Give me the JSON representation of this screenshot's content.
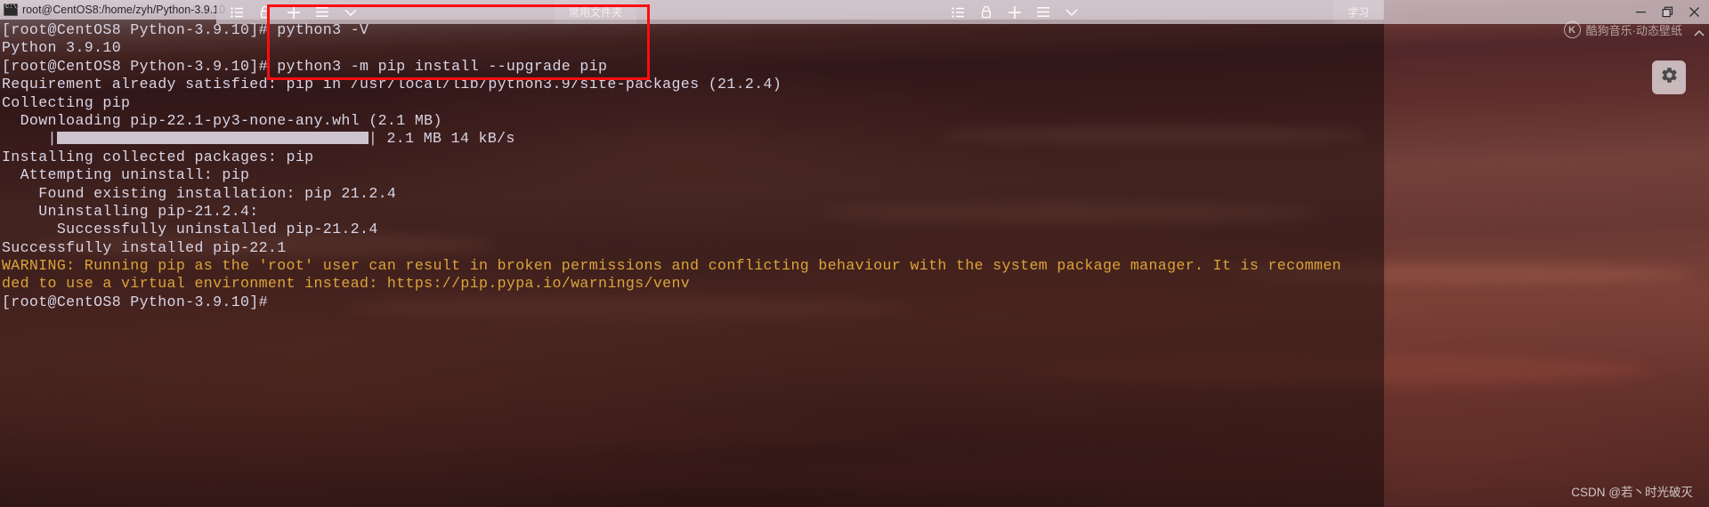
{
  "window": {
    "title": "root@CentOS8:/home/zyh/Python-3.9.10",
    "icon_name": "terminal-icon",
    "minimize_label": "Minimize",
    "maximize_label": "Maximize",
    "close_label": "Close"
  },
  "top_panel": {
    "icons_left": [
      {
        "name": "list-icon",
        "label": "List"
      },
      {
        "name": "lock-icon",
        "label": "Lock"
      },
      {
        "name": "plus-icon",
        "label": "New"
      },
      {
        "name": "hamburger-icon",
        "label": "Menu"
      },
      {
        "name": "chevron-down-icon",
        "label": "More"
      }
    ],
    "tab_favorites": "常用文件夹",
    "icons_right": [
      {
        "name": "list-icon",
        "label": "List"
      },
      {
        "name": "lock-icon",
        "label": "Lock"
      },
      {
        "name": "plus-icon",
        "label": "New"
      },
      {
        "name": "hamburger-icon",
        "label": "Menu"
      },
      {
        "name": "chevron-down-icon",
        "label": "More"
      }
    ],
    "tab_study": "学习"
  },
  "terminal": {
    "prompt": "[root@CentOS8 Python-3.9.10]#",
    "lines": [
      {
        "text": "[root@CentOS8 Python-3.9.10]# python3 -V",
        "color": "normal"
      },
      {
        "text": "Python 3.9.10",
        "color": "normal"
      },
      {
        "text": "[root@CentOS8 Python-3.9.10]# python3 -m pip install --upgrade pip",
        "color": "normal"
      },
      {
        "text": "Requirement already satisfied: pip in /usr/local/lib/python3.9/site-packages (21.2.4)",
        "color": "normal"
      },
      {
        "text": "Collecting pip",
        "color": "normal"
      },
      {
        "text": "  Downloading pip-22.1-py3-none-any.whl (2.1 MB)",
        "color": "normal"
      },
      {
        "text": "PROGRESS_BAR",
        "color": "bar"
      },
      {
        "text": "Installing collected packages: pip",
        "color": "normal"
      },
      {
        "text": "  Attempting uninstall: pip",
        "color": "normal"
      },
      {
        "text": "    Found existing installation: pip 21.2.4",
        "color": "normal"
      },
      {
        "text": "    Uninstalling pip-21.2.4:",
        "color": "normal"
      },
      {
        "text": "      Successfully uninstalled pip-21.2.4",
        "color": "normal"
      },
      {
        "text": "Successfully installed pip-22.1",
        "color": "normal"
      },
      {
        "text": "WARNING: Running pip as the 'root' user can result in broken permissions and conflicting behaviour with the system package manager. It is recommen",
        "color": "warn"
      },
      {
        "text": "ded to use a virtual environment instead: https://pip.pypa.io/warnings/venv",
        "color": "warn"
      },
      {
        "text": "[root@CentOS8 Python-3.9.10]#",
        "color": "normal"
      }
    ],
    "progress": {
      "prefix": "     ",
      "bar_open": "|",
      "bar_close": "|",
      "suffix": " 2.1 MB 14 kB/s",
      "percent": 100,
      "size": "2.1 MB",
      "speed": "14 kB/s"
    }
  },
  "annotation": {
    "red_box_label": "highlighted commands",
    "commands": [
      "python3 -V",
      "python3 -m pip install --upgrade pip"
    ]
  },
  "watermarks": {
    "kugou": "酷狗音乐·动态壁纸",
    "kugou_logo_text": "K",
    "csdn": "CSDN @若丶时光破灭"
  },
  "colors": {
    "annotation_red": "#fc0d0d",
    "terminal_text": "#d9d5e6",
    "warning_text": "#dba43a",
    "panel_bg": "#d0c4cb",
    "progress_fill": "#cdc3cd"
  }
}
